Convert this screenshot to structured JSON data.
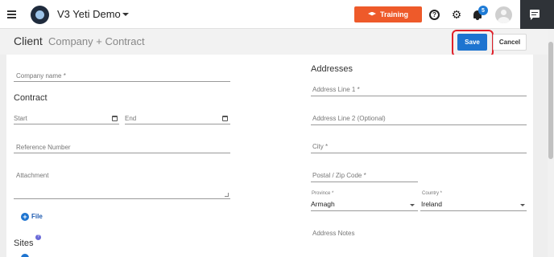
{
  "topbar": {
    "app_title": "V3 Yeti Demo",
    "training_label": "Training",
    "notifications_count": "5"
  },
  "header": {
    "title": "Client",
    "subtitle": "Company + Contract",
    "save_label": "Save",
    "cancel_label": "Cancel"
  },
  "left": {
    "company_name_label": "Company name *",
    "contract_title": "Contract",
    "start_label": "Start",
    "end_label": "End",
    "reference_label": "Reference Number",
    "attachment_label": "Attachment",
    "file_label": "File",
    "sites_title": "Sites",
    "sites_help": "?"
  },
  "right": {
    "addresses_title": "Addresses",
    "address1_label": "Address Line 1 *",
    "address2_label": "Address Line 2 (Optional)",
    "city_label": "City *",
    "postal_label": "Postal / Zip Code *",
    "province_label": "Province *",
    "province_value": "Armagh",
    "country_label": "Country *",
    "country_value": "Ireland",
    "notes_label": "Address Notes"
  },
  "colors": {
    "accent": "#1e74d0",
    "training": "#ee5a2a",
    "highlight": "#e0202a"
  }
}
